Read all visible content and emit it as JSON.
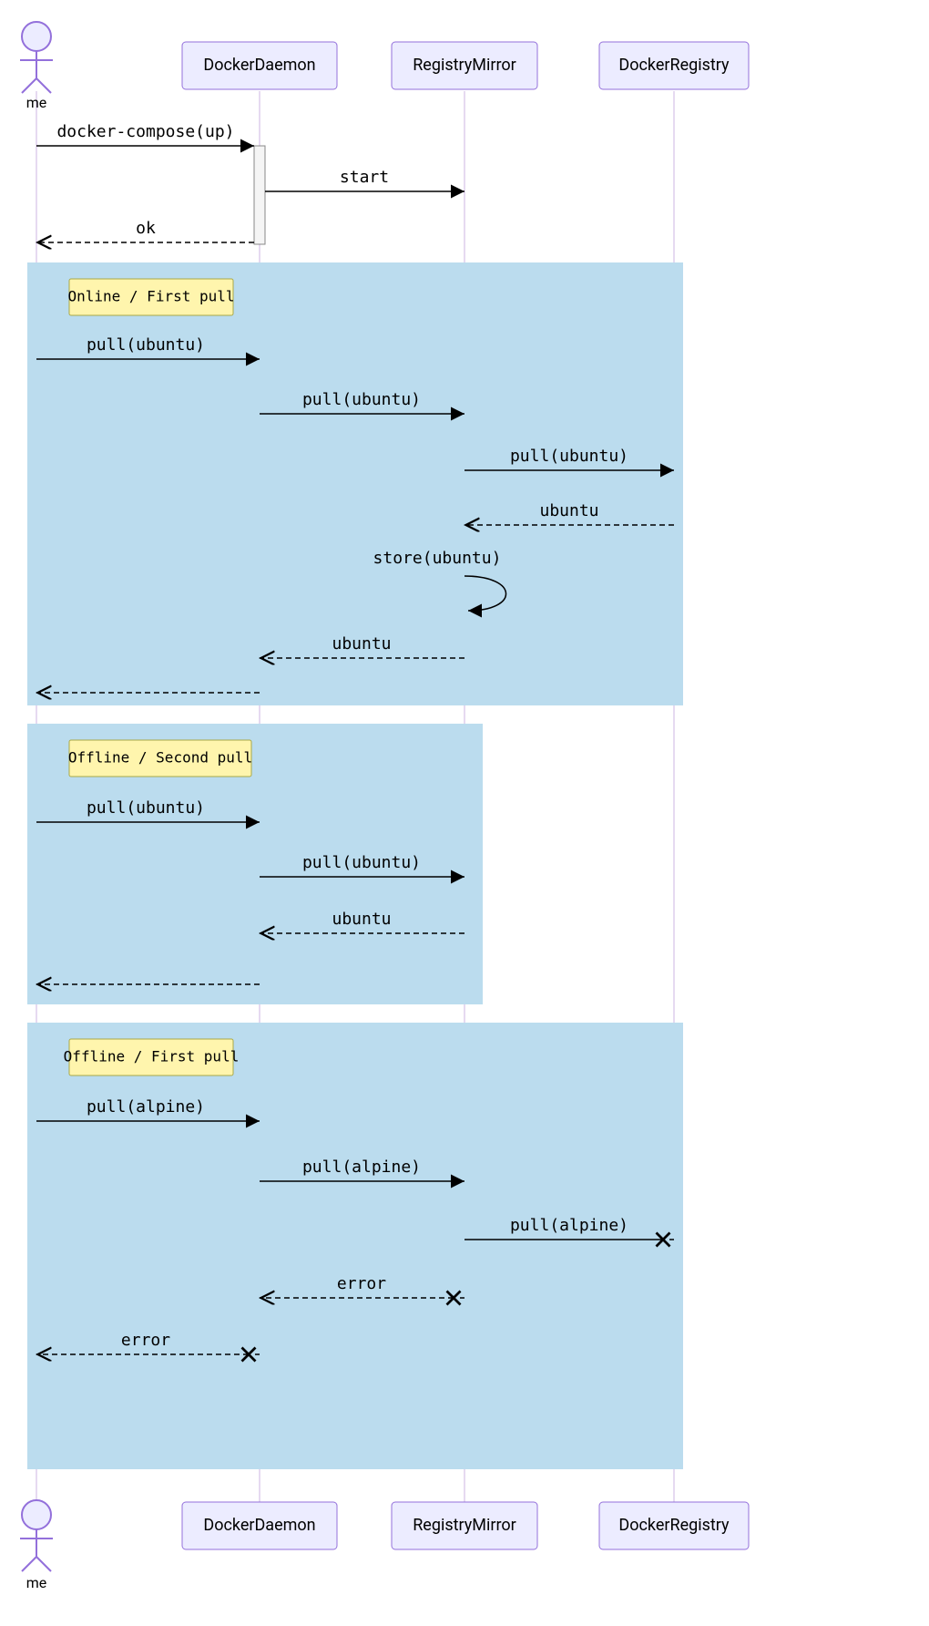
{
  "participants": {
    "me": "me",
    "daemon": "DockerDaemon",
    "mirror": "RegistryMirror",
    "registry": "DockerRegistry"
  },
  "messages": {
    "compose_up": "docker-compose(up)",
    "start": "start",
    "ok": "ok",
    "pull_ubuntu": "pull(ubuntu)",
    "ubuntu": "ubuntu",
    "store_ubuntu": "store(ubuntu)",
    "pull_alpine": "pull(alpine)",
    "error": "error"
  },
  "notes": {
    "online_first": "Online / First pull",
    "offline_second": "Offline / Second pull",
    "offline_first": "Offline / First pull"
  }
}
